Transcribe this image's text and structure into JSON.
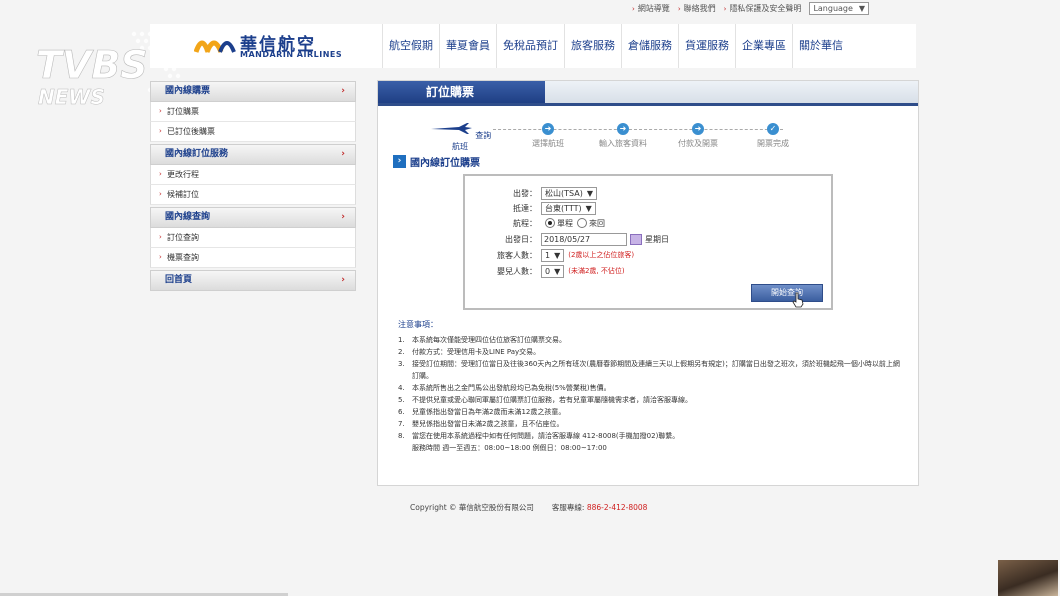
{
  "top_links": [
    "網站導覽",
    "聯絡我們",
    "隱私保護及安全聲明"
  ],
  "language_label": "Language",
  "watermark": {
    "line1": "TVBS",
    "line2": "NEWS"
  },
  "logo": {
    "zh": "華信航空",
    "en": "MANDARIN AIRLINES"
  },
  "nav": [
    "航空假期",
    "華夏會員",
    "免稅品預訂",
    "旅客服務",
    "倉儲服務",
    "貨運服務",
    "企業專區",
    "關於華信"
  ],
  "sidebar": [
    {
      "heading": "國內線購票",
      "items": [
        "訂位購票",
        "已訂位後購票"
      ]
    },
    {
      "heading": "國內線訂位服務",
      "items": [
        "更改行程",
        "候補訂位"
      ]
    },
    {
      "heading": "國內線查詢",
      "items": [
        "訂位查詢",
        "機票查詢"
      ]
    },
    {
      "heading": "回首頁",
      "items": []
    }
  ],
  "main_title": "訂位購票",
  "steps": [
    "查詢航班",
    "選擇航班",
    "輸入旅客資料",
    "付款及開票",
    "開票完成"
  ],
  "section_title": "國內線訂位購票",
  "form": {
    "depart_label": "出發：",
    "depart_value": "松山(TSA)",
    "arrive_label": "抵達：",
    "arrive_value": "台東(TTT)",
    "trip_label": "航程：",
    "trip_oneway": "單程",
    "trip_round": "來回",
    "date_label": "出發日：",
    "date_value": "2018/05/27",
    "weekday": "星期日",
    "adult_label": "旅客人數：",
    "adult_value": "1",
    "adult_note": "(2歲以上之佔位旅客)",
    "infant_label": "嬰兒人數：",
    "infant_value": "0",
    "infant_note": "(未滿2歲, 不佔位)",
    "search_button": "開始查詢"
  },
  "notes_heading": "注意事項：",
  "notes": [
    "本系統每次僅能受理四位佔位旅客訂位購票交易。",
    "付款方式：受理信用卡及LINE Pay交易。",
    "接受訂位期間：受理訂位當日及往後360天內之所有班次(農曆春節期間及連續三天以上假期另有規定)；訂購當日出發之班次，須於班機起飛一個小時以前上網訂購。",
    "本系統所售出之金門馬公出發航段均已為免稅(5%營業稅)售價。",
    "不提供兒童或愛心聯同軍屬訂位購票訂位服務，若有兒童軍屬隨機需求者，請洽客服專線。",
    "兒童係指出發當日為年滿2歲而未滿12歲之孩童。",
    "嬰兒係指出發當日未滿2歲之孩童，且不佔座位。",
    "當您在使用本系統過程中如有任何問題，請洽客服專線 412-8008(手機加撥02)聯繫。",
    "服務時間 週一至週五：08:00~18:00 例假日：08:00~17:00"
  ],
  "footer": {
    "copyright": "Copyright © 華信航空股份有限公司",
    "service_label": "客服專線:",
    "service_phone": "886-2-412-8008"
  }
}
